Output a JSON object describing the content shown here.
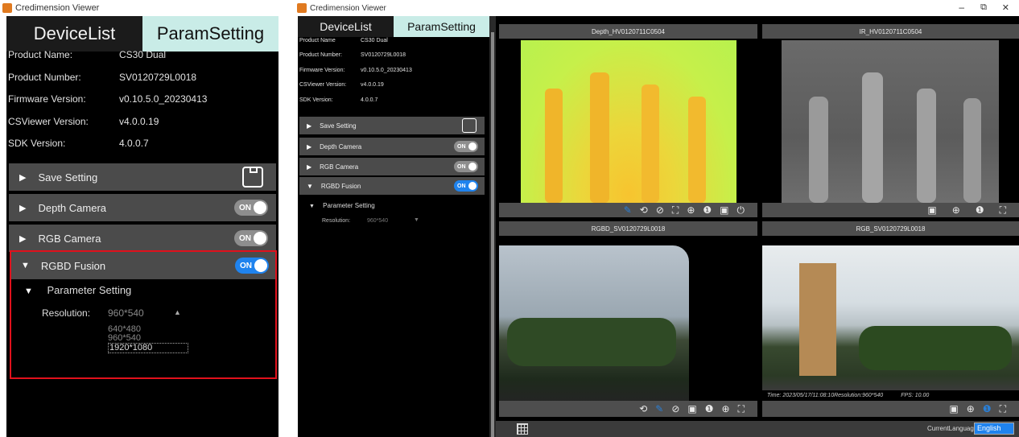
{
  "left": {
    "window_title": "Credimension Viewer",
    "tabs": {
      "device_list": "DeviceList",
      "param_setting": "ParamSetting"
    },
    "info": [
      {
        "label": "Product Name:",
        "value": "CS30 Dual"
      },
      {
        "label": "Product Number:",
        "value": "SV0120729L0018"
      },
      {
        "label": "Firmware Version:",
        "value": "v0.10.5.0_20230413"
      },
      {
        "label": "CSViewer Version:",
        "value": "v4.0.0.19"
      },
      {
        "label": "SDK Version:",
        "value": "4.0.0.7"
      }
    ],
    "sections": {
      "save": "Save Setting",
      "depth": "Depth Camera",
      "rgb": "RGB Camera",
      "rgbd": "RGBD Fusion"
    },
    "toggle_on": "ON",
    "param_setting": "Parameter Setting",
    "resolution_label": "Resolution:",
    "resolution_value": "960*540",
    "resolution_options": [
      "640*480",
      "960*540",
      "1920*1080"
    ]
  },
  "right": {
    "window_title": "Credimension Viewer",
    "window_controls": {
      "min": "–",
      "max": "⧉",
      "close": "✕"
    },
    "tabs": {
      "device_list": "DeviceList",
      "param_setting": "ParamSetting"
    },
    "info": [
      {
        "label": "Product Name",
        "value": "CS30 Dual"
      },
      {
        "label": "Product Number:",
        "value": "SV0120729L0018"
      },
      {
        "label": "Firmware Version:",
        "value": "v0.10.5.0_20230413"
      },
      {
        "label": "CSViewer Version:",
        "value": "v4.0.0.19"
      },
      {
        "label": "SDK Version:",
        "value": "4.0.0.7"
      }
    ],
    "sections": {
      "save": "Save Setting",
      "depth": "Depth Camera",
      "rgb": "RGB Camera",
      "rgbd": "RGBD Fusion"
    },
    "toggle_on": "ON",
    "param_setting": "Parameter Setting",
    "resolution_label": "Resolution:",
    "resolution_value": "960*540",
    "views": {
      "depth": "Depth_HV0120711C0504",
      "ir": "IR_HV0120711C0504",
      "rgbd": "RGBD_SV0120729L0018",
      "rgb": "RGB_SV0120729L0018"
    },
    "rgb_overlay": {
      "time": "Time: 2023/05/17/11:08:10Resolution:960*540",
      "fps": "FPS: 10.00"
    },
    "bottom": {
      "language_label": "CurrentLanguage",
      "language_value": "English"
    }
  },
  "colors": {
    "highlight": "#e0111c",
    "toggle_on": "#1f83ee",
    "tab_active": "#c9ece7"
  }
}
